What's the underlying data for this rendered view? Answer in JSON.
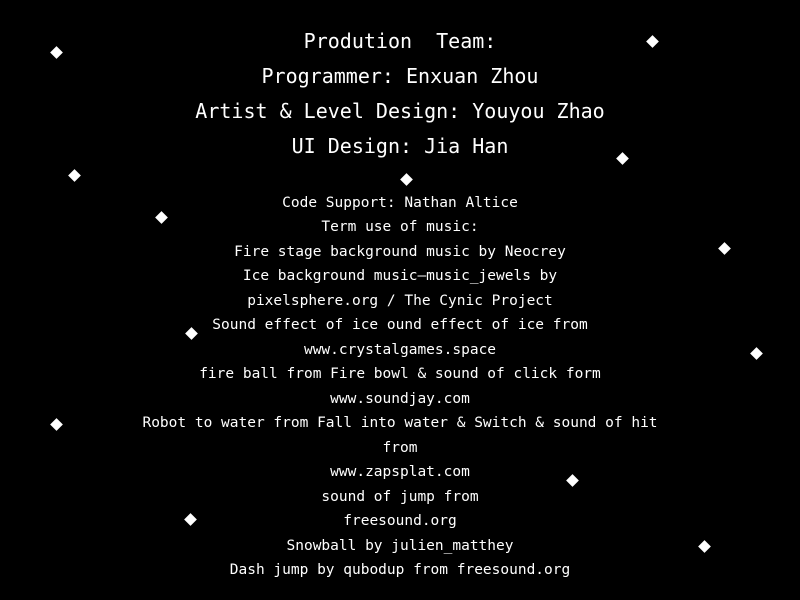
{
  "credits": {
    "heading": "Prodution  Team:",
    "programmer": "Programmer: Enxuan Zhou",
    "artist": "Artist & Level Design: Youyou Zhao",
    "ui_design": "UI Design: Jia Han",
    "lines": [
      "Code Support: Nathan Altice",
      "Term use of music:",
      "Fire stage background music by Neocrey",
      "Ice background music—music_jewels by",
      "pixelsphere.org / The Cynic Project",
      "Sound effect of ice ound effect of ice from",
      "www.crystalgames.space",
      "fire ball from Fire bowl & sound of click form",
      "www.soundjay.com",
      "Robot to water from Fall into water & Switch & sound of hit",
      "from",
      "www.zapsplat.com",
      "sound of jump from",
      "freesound.org",
      "Snowball by julien_matthey",
      "Dash jump by qubodup from freesound.org"
    ]
  },
  "colors": {
    "background": "#000000",
    "text": "#ffffff",
    "sparkle": "#ffffff"
  },
  "decorations": {
    "icon": "diamond-sparkle-icon",
    "count": 16
  }
}
